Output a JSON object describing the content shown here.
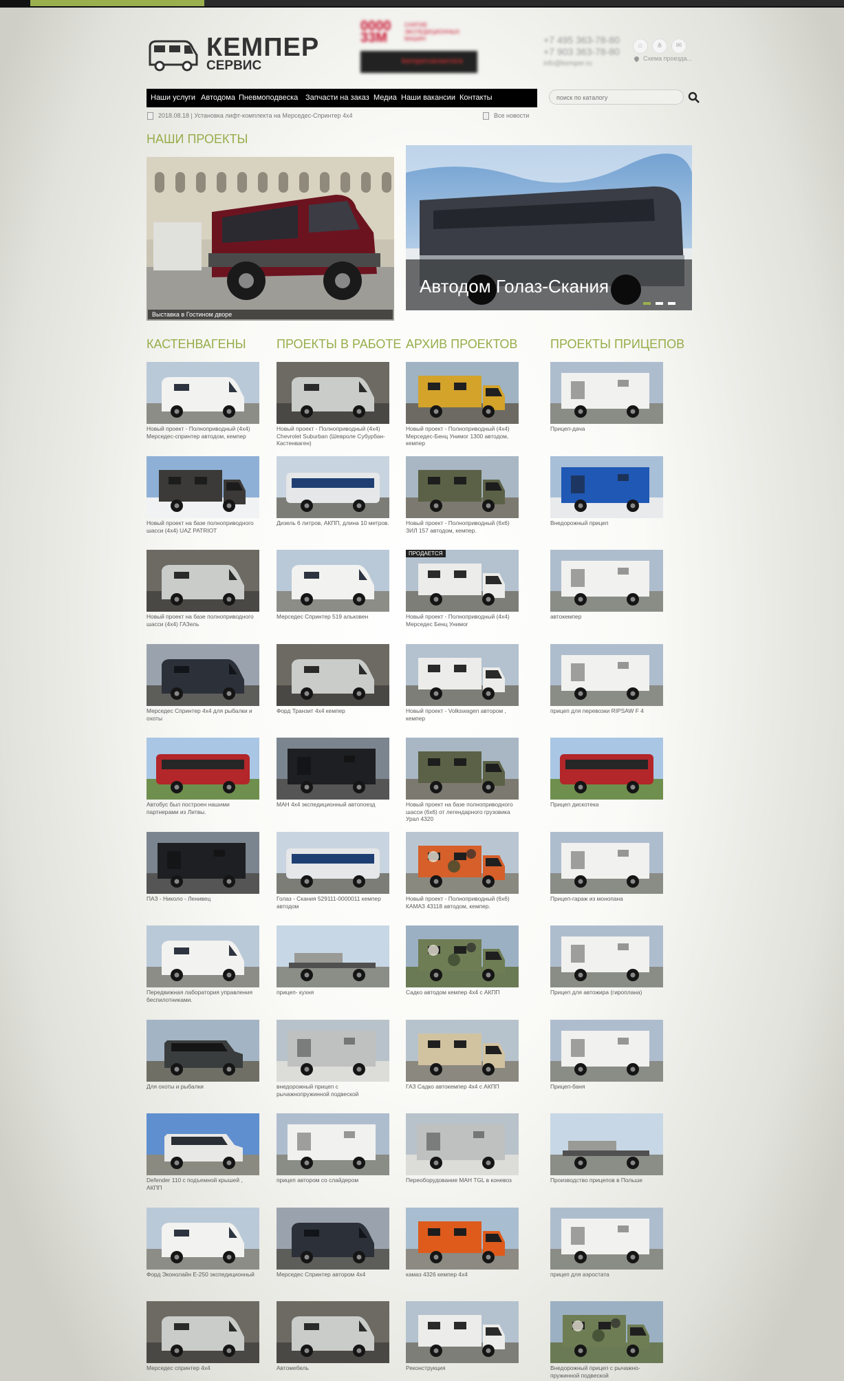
{
  "header": {
    "logo_title": "КЕМПЕР",
    "logo_subtitle": "СЕРВИС",
    "promo_big": "0000 33М",
    "promo_small": "СНЯТИЕ ЭКСПЕДИЦИОННЫХ МАШИН",
    "promo_banner": "kempervanservice",
    "phone1": "+7 495 363-78-80",
    "phone2": "+7 903 363-78-80",
    "email": "info@kemper.ru",
    "map_link": "Схема проезда..."
  },
  "nav": [
    "Наши услуги",
    "Автодома",
    "Пневмоподвеска",
    "Запчасти на заказ",
    "Медиа",
    "Наши вакансии",
    "Контакты"
  ],
  "search": {
    "placeholder": "поиск по каталогу"
  },
  "news": {
    "text": "2018.08.18 | Установка лифт-комплекта на Мерседес-Спринтер 4х4",
    "all": "Все новости"
  },
  "projects_title": "НАШИ ПРОЕКТЫ",
  "featured": {
    "left_caption": "Выставка в Гостином дворе",
    "right_title": "Автодом Голаз-Скания"
  },
  "columns": [
    {
      "title": "КАСТЕНВАГЕНЫ",
      "items": [
        {
          "caption": "Новый проект - Полноприводный (4х4) Мерседес-спринтер автодом, кемпер",
          "theme": "white-van"
        },
        {
          "caption": "Новый проект на базе полноприводного шасси (4х4) UAZ PATRIOT",
          "theme": "snow-truck"
        },
        {
          "caption": "Новый проект на базе полноприводного шасси (4х4) ГАЗель",
          "theme": "workshop"
        },
        {
          "caption": "Мерседес Спринтер 4х4 для рыбалки и охоты",
          "theme": "dark-van"
        },
        {
          "caption": "Автобус был построен нашими партнерами из Литвы.",
          "theme": "red-bus"
        },
        {
          "caption": "ПАЗ - Николо - Ленивец",
          "theme": "black-box"
        },
        {
          "caption": "Передвижная лаборатория управления беспилотниками.",
          "theme": "white-van"
        },
        {
          "caption": "Для охоты и рыбалки",
          "theme": "dark-suv"
        },
        {
          "caption": "Defender 110 с подъемной крышей , АКПП",
          "theme": "white-suv"
        },
        {
          "caption": "Форд Эконолайн Е-250 экспедиционный",
          "theme": "white-van"
        },
        {
          "caption": "Мерседес спринтер 4х4",
          "theme": "workshop"
        }
      ]
    },
    {
      "title": "ПРОЕКТЫ В РАБОТЕ",
      "items": [
        {
          "caption": "Новый проект - Полноприводный (4х4) Chevrolet Suburban (Шевроле Субурбан-Кастенваген)",
          "theme": "workshop"
        },
        {
          "caption": "Дизель 6 литров, АКПП, длина 10 метров.",
          "theme": "bus"
        },
        {
          "caption": "Мерседес Спринтер 519 альковен",
          "theme": "white-van"
        },
        {
          "caption": "Форд Транзит 4х4 кемпер",
          "theme": "workshop"
        },
        {
          "caption": "МАН 4х4 экспедиционный автопоезд",
          "theme": "black-box"
        },
        {
          "caption": "Голаз - Скания 529111-0000011 кемпер автодом",
          "theme": "bus"
        },
        {
          "caption": "прицеп- кухня",
          "theme": "trailer-flat"
        },
        {
          "caption": "внедорожный прицеп с рычажнопружинной подвеской",
          "theme": "grey-trailer"
        },
        {
          "caption": "прицеп автором со слайдером",
          "theme": "white-box"
        },
        {
          "caption": "Мерседес Спринтер автором 4х4",
          "theme": "dark-van"
        },
        {
          "caption": "Автомебель",
          "theme": "workshop"
        }
      ]
    },
    {
      "title": "АРХИВ ПРОЕКТОВ",
      "items": [
        {
          "caption": "Новый проект - Полноприводный (4х4) Мерседес-Бенц Унимог 1300 автодом, кемпер",
          "theme": "yellow-truck"
        },
        {
          "caption": "Новый проект - Полноприводный (6х6) ЗИЛ 157 автодом, кемпер.",
          "theme": "military"
        },
        {
          "caption": "Новый проект - Полноприводный (4х4) Мерседес Бенц Унимог",
          "theme": "white-truck",
          "badge": "ПРОДАЕТСЯ"
        },
        {
          "caption": "Новый проект - Volkswagen автором , кемпер",
          "theme": "white-truck"
        },
        {
          "caption": "Новый проект на базе полноприводного шасси (6х6) от легендарного грузовика Урал 4320",
          "theme": "military"
        },
        {
          "caption": "Новый проект - Полноприводный (6х6) КАМАЗ 43118 автодом, кемпер.",
          "theme": "camo-orange"
        },
        {
          "caption": "Садко автодом кемпер 4х4 с АКПП",
          "theme": "camo-green"
        },
        {
          "caption": "ГАЗ Садко автокемпер 4х4 с АКПП",
          "theme": "beige-truck"
        },
        {
          "caption": "Переоборудование МАН TGL в коневоз",
          "theme": "grey-trailer"
        },
        {
          "caption": "камаз 4326 кемпер 4х4",
          "theme": "orange-truck"
        },
        {
          "caption": "Реконструкция",
          "theme": "white-truck"
        }
      ]
    },
    {
      "title": "ПРОЕКТЫ ПРИЦЕПОВ",
      "items": [
        {
          "caption": "Прицеп-дача",
          "theme": "white-box"
        },
        {
          "caption": "Внедорожный прицеп",
          "theme": "blue-trailer"
        },
        {
          "caption": "автокемпер",
          "theme": "white-box"
        },
        {
          "caption": "прицеп для перевозки RIPSAW F 4",
          "theme": "white-box"
        },
        {
          "caption": "Прицеп дискотека",
          "theme": "red-bus"
        },
        {
          "caption": "Прицеп-гараж из монопана",
          "theme": "white-box"
        },
        {
          "caption": "Прицеп для автожира (гироплана)",
          "theme": "white-box"
        },
        {
          "caption": "Прицеп-баня",
          "theme": "white-box"
        },
        {
          "caption": "Производство прицепов в Польше",
          "theme": "trailer-flat"
        },
        {
          "caption": "прицеп для аэростата",
          "theme": "white-box"
        },
        {
          "caption": "Внедорожный прицеп с рычажно-пружинной подвеской",
          "theme": "camo-green"
        }
      ]
    }
  ]
}
